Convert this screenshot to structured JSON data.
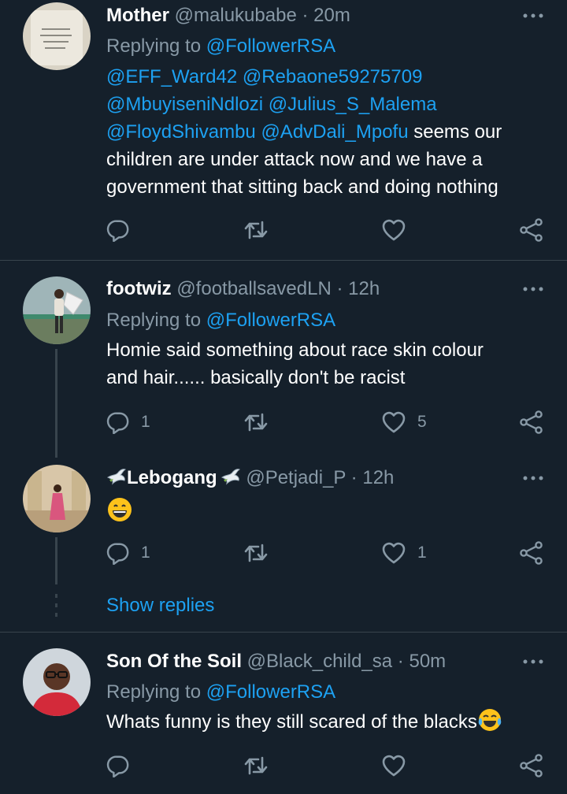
{
  "colors": {
    "background": "#15202b",
    "text": "#ffffff",
    "secondary": "#8899a6",
    "link": "#1da1f2",
    "divider": "#38444d"
  },
  "tweets": [
    {
      "name": "Mother",
      "handle": "@malukubabe",
      "dot": "·",
      "time": "20m",
      "replying_label": "Replying to",
      "replying_to": "@FollowerRSA",
      "body_mentions_1": "@EFF_Ward42 @Rebaone59275709",
      "body_mentions_2": "@MbuyiseniNdlozi @Julius_S_Malema",
      "body_mentions_3a": "@FloydShivambu @AdvDali_Mpofu",
      "body_text_3b": " seems our",
      "body_text_4": "children are under attack now and we have a",
      "body_text_5": "government that sitting back and doing nothing",
      "reply_count": "",
      "like_count": ""
    },
    {
      "name": "footwiz",
      "handle": "@footballsavedLN",
      "dot": "·",
      "time": "12h",
      "replying_label": "Replying to",
      "replying_to": "@FollowerRSA",
      "body_line_1": "Homie said something about race skin colour",
      "body_line_2": "and hair...... basically don't be racist",
      "reply_count": "1",
      "like_count": "5"
    },
    {
      "name_prefix_icon": "dove-icon",
      "name": "Lebogang",
      "handle": "@Petjadi_P",
      "dot": "·",
      "time": "12h",
      "body_emoji": "grinning-face-emoji",
      "reply_count": "1",
      "like_count": "1"
    },
    {
      "name": "Son Of the Soil",
      "handle": "@Black_child_sa",
      "dot": "·",
      "time": "50m",
      "replying_label": "Replying to",
      "replying_to": "@FollowerRSA",
      "body_text": "Whats funny is they still scared of the blacks",
      "body_emoji": "tears-of-joy-emoji",
      "reply_count": "",
      "like_count": ""
    }
  ],
  "show_replies_label": "Show replies",
  "icons": {
    "reply": "reply-icon",
    "retweet": "retweet-icon",
    "like": "heart-icon",
    "share": "share-icon",
    "more": "more-dots-icon"
  }
}
